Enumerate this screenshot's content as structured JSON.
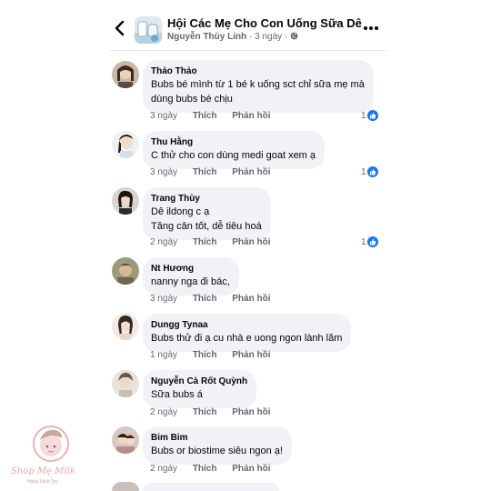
{
  "header": {
    "group_title": "Hội Các Mẹ Cho Con Uống Sữa Dê",
    "author": "Nguyễn Thùy Linh",
    "time": "· 3 ngày ·"
  },
  "comments": [
    {
      "name": "Thảo Thảo",
      "lines": [
        "Bubs bé mình từ 1 bé k uống sct chỉ sữa mẹ mà",
        "dùng bubs bé chịu"
      ],
      "time": "3 ngày",
      "like": "Thích",
      "reply": "Phản hồi",
      "reactions": "1"
    },
    {
      "name": "Thu Hằng",
      "lines": [
        "C thử cho con dùng medi goat xem ạ"
      ],
      "time": "3 ngày",
      "like": "Thích",
      "reply": "Phản hồi",
      "reactions": "1"
    },
    {
      "name": "Trang Thùy",
      "lines": [
        "Dê ildong c ạ",
        "Tăng cân tốt, dễ tiêu hoá"
      ],
      "time": "2 ngày",
      "like": "Thích",
      "reply": "Phản hồi",
      "reactions": "1"
    },
    {
      "name": "Nt Hương",
      "lines": [
        "nanny nga đi bác,"
      ],
      "time": "3 ngày",
      "like": "Thích",
      "reply": "Phản hồi",
      "reactions": ""
    },
    {
      "name": "Dungg Tynaa",
      "lines": [
        "Bubs thử đi ạ cu nhà e uong ngon lành lăm"
      ],
      "time": "1 ngày",
      "like": "Thích",
      "reply": "Phản hồi",
      "reactions": ""
    },
    {
      "name": "Nguyễn Cà Rốt Quỳnh",
      "lines": [
        "Sữa bubs á"
      ],
      "time": "2 ngày",
      "like": "Thích",
      "reply": "Phản hồi",
      "reactions": ""
    },
    {
      "name": "Bim Bim",
      "lines": [
        "Bubs or biostime siêu ngon ạ!"
      ],
      "time": "2 ngày",
      "like": "Thích",
      "reply": "Phản hồi",
      "reactions": ""
    }
  ],
  "watermark": {
    "brand": "Shop Mẹ Milk",
    "tagline": "Hàng Xách Tay"
  },
  "colors": {
    "bubble": "#f0f2f5",
    "meta": "#65676b",
    "like_blue": "#1877f2",
    "watermark_pink": "#e8a7a7"
  }
}
